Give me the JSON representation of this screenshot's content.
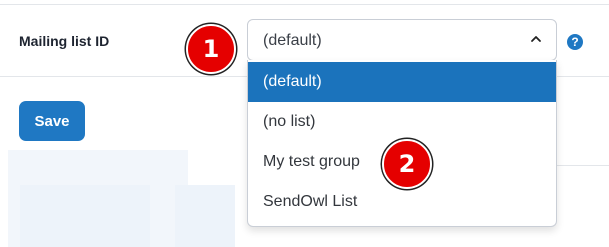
{
  "form": {
    "field_label": "Mailing list ID",
    "select_value": "(default)",
    "help_icon": "?",
    "chevron_icon": "chevron-up-icon",
    "options": [
      {
        "label": "(default)",
        "selected": true
      },
      {
        "label": "(no list)",
        "selected": false
      },
      {
        "label": "My test group",
        "selected": false
      },
      {
        "label": "SendOwl List",
        "selected": false
      }
    ],
    "save_label": "Save"
  },
  "annotations": {
    "badge_1": "1",
    "badge_2": "2"
  },
  "colors": {
    "accent": "#1f78c3",
    "selected_option": "#1b73bc",
    "badge": "#e50000"
  }
}
